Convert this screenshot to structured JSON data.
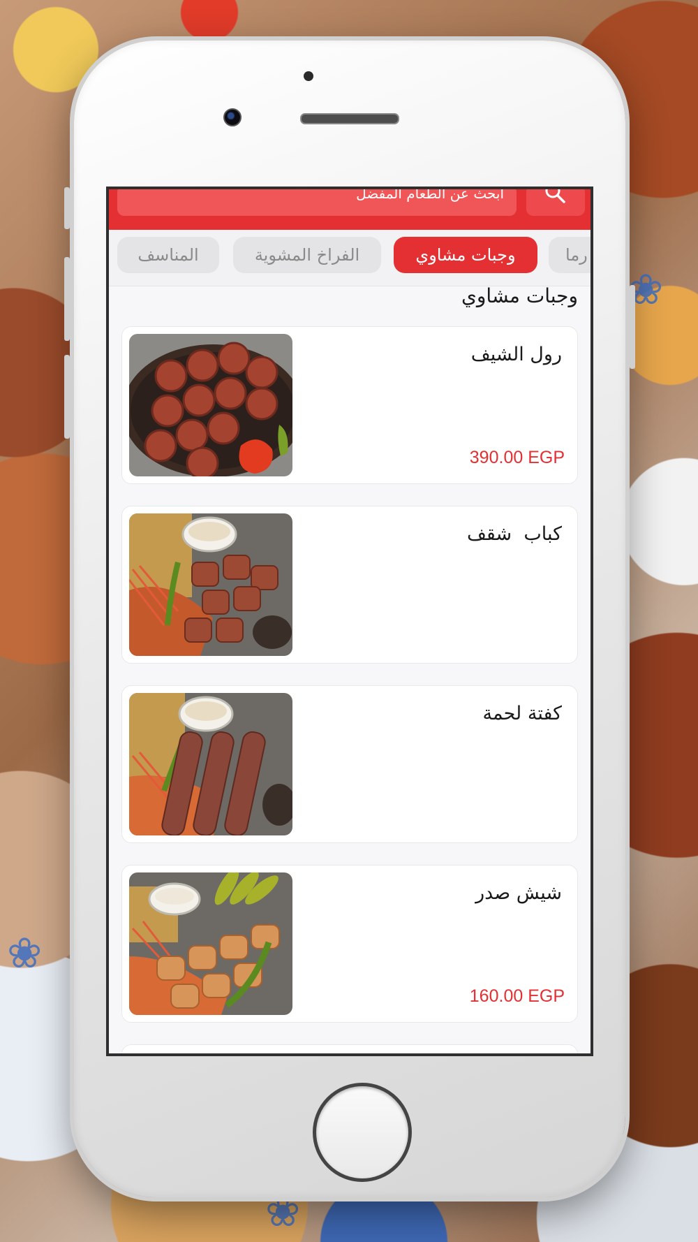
{
  "search": {
    "placeholder": "ابحث عن الطعام المفضل"
  },
  "tabs": [
    {
      "label": "رما",
      "active": false
    },
    {
      "label": "وجبات مشاوي",
      "active": true
    },
    {
      "label": "الفراخ المشوية",
      "active": false
    },
    {
      "label": "المناسف",
      "active": false
    }
  ],
  "section": {
    "title": "وجبات مشاوي"
  },
  "items": [
    {
      "name": "رول الشيف",
      "price": "390.00 EGP",
      "image": "grilled-rolls-photo"
    },
    {
      "name": "كباب  شقف",
      "price": "",
      "image": "kebab-platter-photo"
    },
    {
      "name": "كفتة لحمة",
      "price": "",
      "image": "kofta-platter-photo"
    },
    {
      "name": "شيش صدر",
      "price": "160.00 EGP",
      "image": "shish-tawook-photo"
    }
  ],
  "icons": {
    "search": "search-icon"
  },
  "colors": {
    "accent": "#e42f33",
    "tab_inactive_bg": "#e4e4e6",
    "tab_inactive_text": "#8a8a8a",
    "price": "#e42f33"
  }
}
